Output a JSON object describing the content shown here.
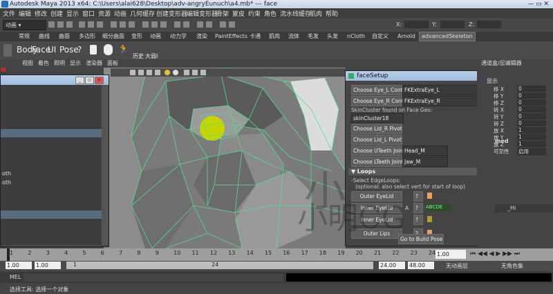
{
  "title_bar": {
    "text": "Autodesk Maya 2013 x64: C:\\Users\\alai628\\Desktop\\adv-angryEunuch\\a4.mb*   ---   face"
  },
  "menu": [
    "文件",
    "编辑",
    "修改",
    "创建",
    "显示",
    "窗口",
    "资源",
    "动画",
    "几何缓存",
    "创建变形器",
    "编辑变形器",
    "骨架",
    "蒙皮",
    "约束",
    "角色",
    "流水线缓存",
    "肌肉",
    "帮助"
  ],
  "status_line": {
    "mode": "动画",
    "x_label": "X:",
    "y_label": "Y:",
    "z_label": "Z:"
  },
  "shelf_tabs": [
    "常规",
    "曲线",
    "曲面",
    "多边形",
    "细分曲面",
    "变形",
    "动画",
    "动力学",
    "渲染",
    "PaintEffects",
    "卡通",
    "肌肉",
    "流体",
    "毛发",
    "头发",
    "nCloth",
    "自定义",
    "Arnold",
    "advancedSkeleton"
  ],
  "shelf_buttons": [
    "Body",
    "Face",
    "UI",
    "Pose",
    "?",
    "历史",
    "大弱I"
  ],
  "panel_menu": [
    "视图",
    "着色",
    "照明",
    "显示",
    "渲染器",
    "面板"
  ],
  "channel_box": {
    "header": "通道盒/层编辑器",
    "display_label": "显示",
    "rows": [
      "移 X",
      "移 Y",
      "移 Z",
      "转 X",
      "转 Y",
      "转 Z",
      "放 X",
      "放 Y",
      "放 Z",
      "可见性"
    ],
    "values": [
      "0",
      "0",
      "0",
      "0",
      "0",
      "0",
      "1",
      "1",
      "1",
      "启用"
    ],
    "section": "med",
    "layer_item": "_Hi"
  },
  "face_setup": {
    "title": "faceSetup",
    "rows": [
      {
        "button": "Choose Eye_L Control",
        "field": "FKExtraEye_L"
      },
      {
        "button": "Choose Eye_R Control",
        "field": "FKExtraEye_R"
      }
    ],
    "skin_label": "SkinCluster found on Face Geo:",
    "skin_field": "skinCluster18",
    "pivot_buttons": [
      "Choose Lid_R Pivot",
      "Choose Lid_L Pivot"
    ],
    "joint_rows": [
      {
        "button": "Choose UTeeth Joint",
        "field": "Head_M"
      },
      {
        "button": "Choose LTeeth Joint",
        "field": "Jaw_M"
      }
    ],
    "loops_header": "Loops",
    "loops_note1": "-Select EdgeLoops:",
    "loops_note2": "(optional: also select vert for start of loop)",
    "loop_buttons": [
      "Outer EyeLid",
      "Inner EyeLid",
      "Inner EyeLid",
      "Outer Lips"
    ],
    "q": "?",
    "a_label": "A",
    "abcde": "ABCDE",
    "build_button": "Go to Build Pose"
  },
  "small_win": {
    "items": [
      "oth",
      "oth"
    ]
  },
  "timeline": {
    "ticks": [
      "1",
      "2",
      "3",
      "4",
      "5",
      "6",
      "7",
      "8",
      "9",
      "10",
      "11",
      "12",
      "13",
      "14",
      "15",
      "16",
      "17",
      "18",
      "19",
      "20",
      "21",
      "22",
      "23",
      "24"
    ],
    "current": "1.00"
  },
  "range": {
    "start": "1.00",
    "start2": "1.00",
    "mid": "1",
    "end_label": "24",
    "end": "24.00",
    "end2": "48.00",
    "anim_layer": "无动画层",
    "char_set": "无角色集"
  },
  "command": {
    "label": "MEL"
  },
  "help_line": {
    "text": "选择工具: 选择一个对象"
  },
  "watermark": "小明CG",
  "colors": {
    "wire": "#4fe08a",
    "eye": "#c8d400",
    "window_title": "#a9c4e2"
  }
}
